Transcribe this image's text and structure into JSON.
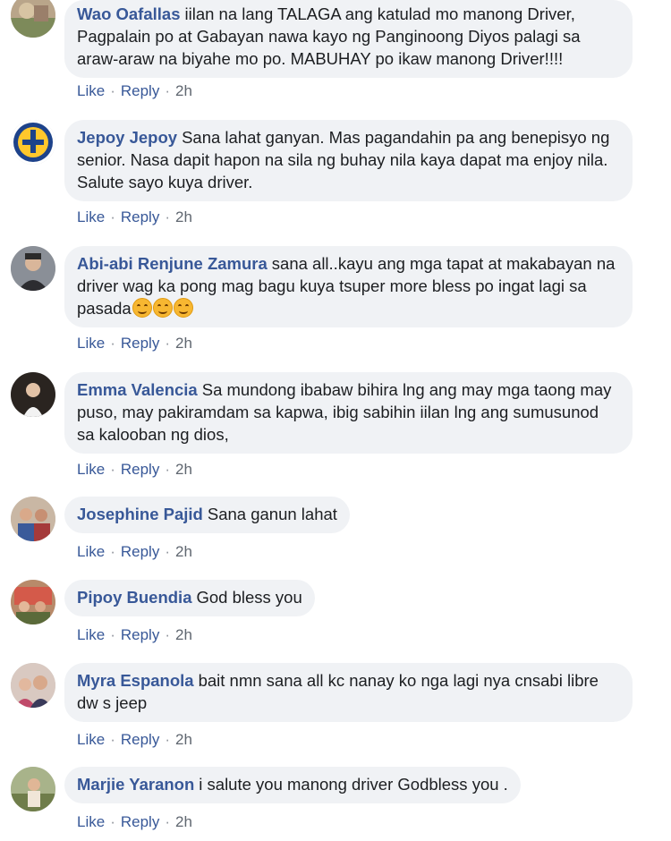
{
  "comments": [
    {
      "author": "Wao Oafallas",
      "text": "iilan na lang TALAGA ang katulad mo manong Driver, Pagpalain po at Gabayan nawa kayo ng Panginoong Diyos palagi sa araw-araw na biyahe mo po. MABUHAY po ikaw manong Driver!!!!",
      "like": "Like",
      "reply": "Reply",
      "time": "2h",
      "avatar_icon": "profile-photo-landscape"
    },
    {
      "author": "Jepoy Jepoy",
      "text": "Sana lahat ganyan. Mas pagandahin pa ang benepisyo ng senior. Nasa dapit hapon na sila ng buhay nila kaya dapat ma enjoy nila. Salute sayo kuya driver.",
      "like": "Like",
      "reply": "Reply",
      "time": "2h",
      "avatar_icon": "team-logo-circle"
    },
    {
      "author": "Abi-abi Renjune Zamura",
      "text": "sana all..kayu ang mga tapat at makabayan na driver wag ka pong mag bagu kuya tsuper more bless po ingat lagi sa pasada",
      "emoji": "smiling-face-emoji x3",
      "like": "Like",
      "reply": "Reply",
      "time": "2h",
      "avatar_icon": "profile-photo-man"
    },
    {
      "author": "Emma Valencia",
      "text": "Sa mundong ibabaw bihira lng ang may mga taong may puso, may pakiramdam sa kapwa, ibig sabihin iilan lng ang sumusunod sa kalooban ng dios,",
      "like": "Like",
      "reply": "Reply",
      "time": "2h",
      "avatar_icon": "profile-photo-woman"
    },
    {
      "author": "Josephine Pajid",
      "text": "Sana ganun lahat",
      "like": "Like",
      "reply": "Reply",
      "time": "2h",
      "avatar_icon": "profile-photo-group"
    },
    {
      "author": "Pipoy Buendia",
      "text": "God bless you",
      "like": "Like",
      "reply": "Reply",
      "time": "2h",
      "avatar_icon": "profile-photo-group"
    },
    {
      "author": "Myra Espanola",
      "text": "bait nmn sana all kc nanay ko nga lagi nya cnsabi libre dw s jeep",
      "like": "Like",
      "reply": "Reply",
      "time": "2h",
      "avatar_icon": "profile-photo-group"
    },
    {
      "author": "Marjie Yaranon",
      "text": "i salute you manong driver Godbless you .",
      "like": "Like",
      "reply": "Reply",
      "time": "2h",
      "avatar_icon": "profile-photo-outdoor"
    }
  ],
  "colors": {
    "author": "#385898",
    "text": "#1c1e21",
    "bubble": "#f0f2f5",
    "meta": "#606770"
  }
}
